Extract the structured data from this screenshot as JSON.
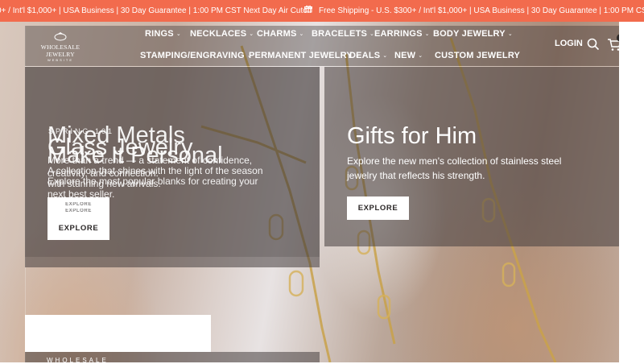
{
  "announcement": {
    "message_left": "0+ / Int'l $1,000+ | USA Business | 30 Day Guarantee | 1:00 PM CST Next Day Air Cutoff",
    "message_right": "Free Shipping - U.S. $300+ / Int'l $1,000+ | USA Business | 30 Day Guarantee | 1:00 PM CST Next Day",
    "gift_icon": "gift-icon",
    "background": "#f26b4d"
  },
  "brand": {
    "name": "WHOLESALE JEWELRY",
    "sub": "WEBSITE"
  },
  "nav": {
    "row1": [
      "RINGS",
      "NECKLACES",
      "CHARMS",
      "BRACELETS",
      "EARRINGS",
      "BODY JEWELRY"
    ],
    "row2": [
      "STAMPING/ENGRAVING",
      "PERMANENT JEWELRY",
      "DEALS",
      "NEW"
    ],
    "custom": "CUSTOM JEWELRY",
    "login": "LOGIN",
    "cart_count": "0"
  },
  "promos": {
    "left": {
      "eyebrow": "SPRING 101",
      "title_1": "Mixed Metals",
      "title_2": "Glass Jewelry",
      "title_3": "Make It Personal",
      "desc_1": "More than a trend — a statement of confidence, creativity, and connection.",
      "desc_2": "A collection that shines with the light of the season with stunning new arrivals.",
      "desc_3": "Explore the most popular blanks for creating your next best seller.",
      "button_ghost_1": "EXPLORE",
      "button_ghost_2": "EXPLORE",
      "button": "EXPLORE"
    },
    "right": {
      "title": "Gifts for Him",
      "desc": "Explore the new men's collection of stainless steel jewelry that reflects his strength.",
      "button": "EXPLORE"
    },
    "bottom": {
      "eyebrow": "WHOLESALE"
    }
  }
}
